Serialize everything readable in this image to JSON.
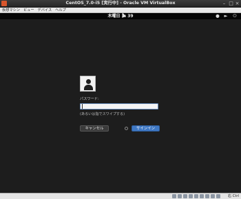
{
  "window": {
    "title": "CentOS_7.0-i5 [実行中] - Oracle VM VirtualBox",
    "minimize": "–",
    "maximize": "□",
    "close": "×"
  },
  "menu": {
    "items": [
      "仮想マシン",
      "ビュー",
      "デバイス",
      "ヘルプ"
    ]
  },
  "guest_topbar": {
    "clock": "木曜日 1: 39",
    "icons": [
      "accessibility-icon",
      "volume-icon",
      "power-icon"
    ]
  },
  "login": {
    "password_label": "パスワード:",
    "password_value": "",
    "hint": "(あるいは指でスワイプする)",
    "cancel_label": "キャンセル",
    "signin_label": "サインイン"
  },
  "statusbar": {
    "host_key": "右 Ctrl"
  },
  "colors": {
    "background": "#1d1d1d",
    "signin_button": "#3f78c4",
    "input_border": "#6a8fbf"
  }
}
